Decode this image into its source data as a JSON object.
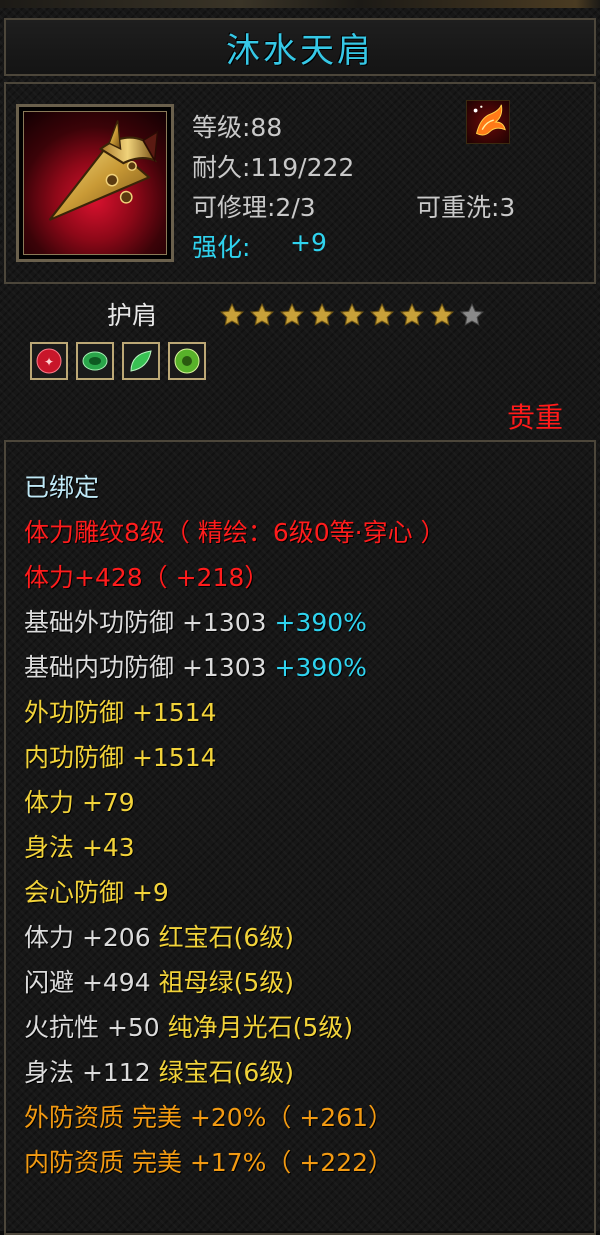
{
  "item": {
    "name": "沐水天肩",
    "level": "等级:88",
    "durability": "耐久:119/222",
    "repairable": "可修理:2/3",
    "rewash": "可重洗:3",
    "enhance_label": "强化:",
    "enhance_value": "+9",
    "type": "护肩",
    "stars_total": 9,
    "stars_filled": 8,
    "rarity": "贵重"
  },
  "gems": [
    {
      "name": "red-gem-icon",
      "color": "#c8162a"
    },
    {
      "name": "green-gem-icon",
      "color": "#2aa64a"
    },
    {
      "name": "green-leaf-gem-icon",
      "color": "#39c154"
    },
    {
      "name": "jade-gem-icon",
      "color": "#58b22a"
    }
  ],
  "attributes": {
    "bound": "已绑定",
    "engraving": "体力雕纹8级（ 精绘：6级0等·穿心 ）",
    "engraving_bonus": "体力+428（ +218）",
    "base_outer_def_label": "基础外功防御",
    "base_outer_def_value": "+1303",
    "base_outer_def_pct": "+390%",
    "base_inner_def_label": "基础内功防御",
    "base_inner_def_value": "+1303",
    "base_inner_def_pct": "+390%",
    "outer_def": "外功防御 +1514",
    "inner_def": "内功防御 +1514",
    "stamina": "体力 +79",
    "agility": "身法 +43",
    "crit_def": "会心防御 +9",
    "gem_line_1_stat": "体力 +206",
    "gem_line_1_gem": "红宝石(6级)",
    "gem_line_2_stat": "闪避 +494",
    "gem_line_2_gem": "祖母绿(5级)",
    "gem_line_3_stat": "火抗性 +50",
    "gem_line_3_gem": "纯净月光石(5级)",
    "gem_line_4_stat": "身法 +112",
    "gem_line_4_gem": "绿宝石(6级)",
    "qual_outer": "外防资质   完美 +20%（ +261）",
    "qual_inner": "内防资质   完美 +17%（ +222）"
  },
  "colors": {
    "title": "#36c8e6",
    "cyan": "#2fd3ef",
    "red": "#ff1c1c",
    "yellow": "#f2d33a",
    "orange": "#f29a12",
    "star_gold": "#c8a13a",
    "star_empty": "#8a8a8a"
  }
}
